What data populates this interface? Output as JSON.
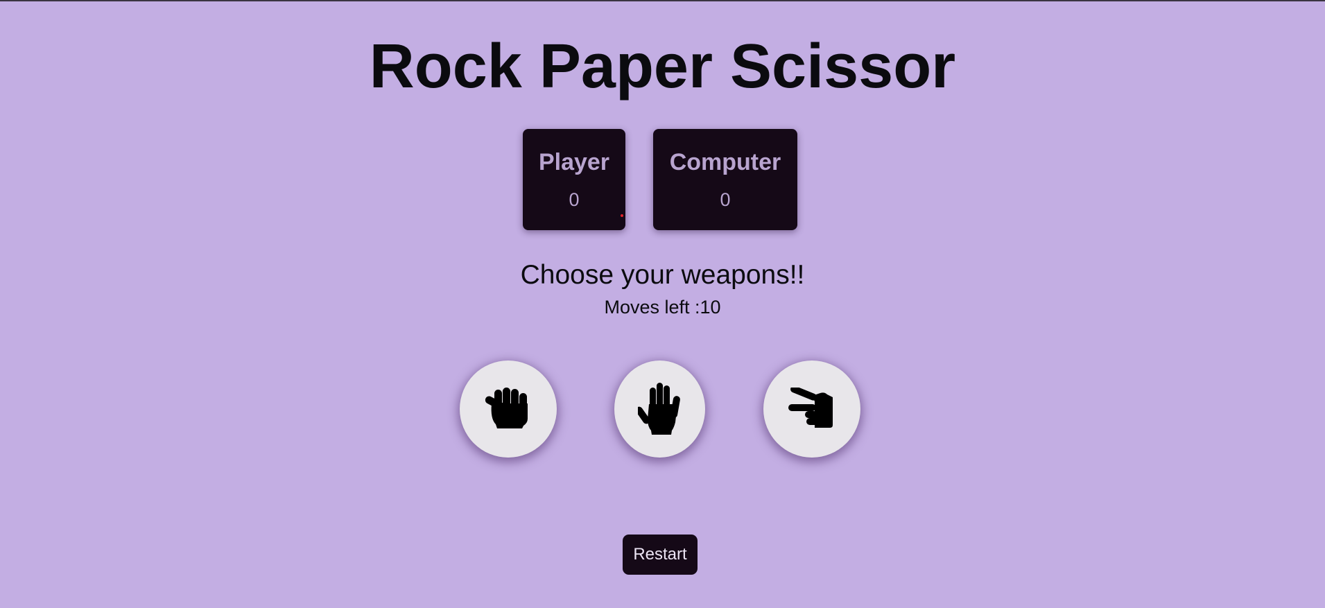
{
  "title": "Rock Paper Scissor",
  "scoreboard": {
    "player": {
      "label": "Player",
      "score": "0"
    },
    "computer": {
      "label": "Computer",
      "score": "0"
    }
  },
  "message": "Choose your weapons!!",
  "moves_left": "Moves left :10",
  "choices": [
    {
      "name": "rock",
      "icon": "hand-fist-icon"
    },
    {
      "name": "paper",
      "icon": "hand-palm-icon"
    },
    {
      "name": "scissors",
      "icon": "hand-scissors-icon"
    }
  ],
  "restart_label": "Restart",
  "colors": {
    "background": "#c3aee3",
    "panel": "#150917",
    "panel_text": "#b8a4cf",
    "choice_bg": "#e8e6ea"
  }
}
